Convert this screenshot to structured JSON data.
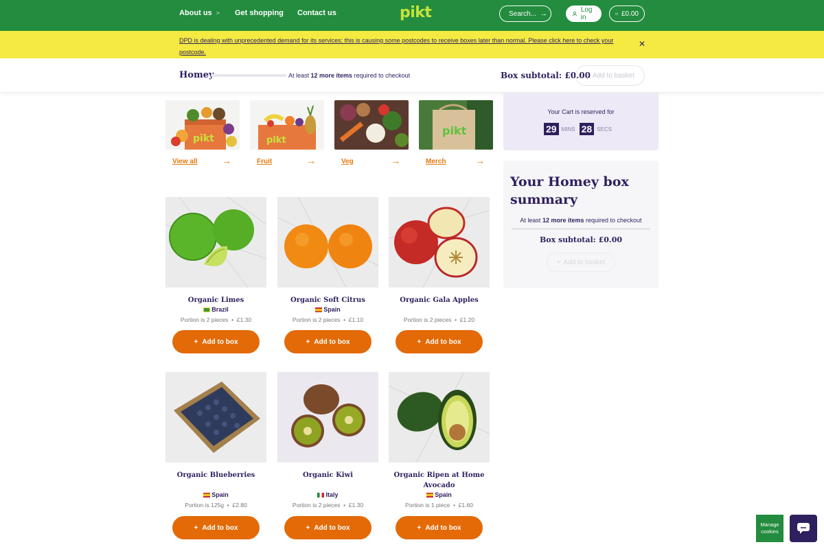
{
  "nav": {
    "about": "About us",
    "shopping": "Get shopping",
    "contact": "Contact us",
    "logo": "pikt",
    "search": "Search...",
    "login": "Log in",
    "cart": "£0.00"
  },
  "banner": {
    "message": "DPD is dealing with unprecedented demand for its services; this is causing some postcodes to receive boxes later than normal. Please click here to check your postcode."
  },
  "progress": {
    "box_name": "Homey",
    "text_prefix": "At least",
    "items_required": "12 more items",
    "text_suffix": "required to checkout",
    "subtotal": "Box subtotal: £0.00",
    "add_to_basket": "Add to basket"
  },
  "categories": [
    {
      "label": "View all"
    },
    {
      "label": "Fruit"
    },
    {
      "label": "Veg"
    },
    {
      "label": "Merch"
    }
  ],
  "products": [
    {
      "name": "Organic Limes",
      "origin": "Brazil",
      "portion": "Portion is 2 pieces",
      "price": "£1.30",
      "button": "Add to box"
    },
    {
      "name": "Organic Soft Citrus",
      "origin": "Spain",
      "portion": "Portion is 2 pieces",
      "price": "£1.10",
      "button": "Add to box"
    },
    {
      "name": "Organic Gala Apples",
      "origin": "",
      "portion": "Portion is 2 pieces",
      "price": "£1.20",
      "button": "Add to box"
    },
    {
      "name": "Organic Blueberries",
      "origin": "Spain",
      "portion": "Portion is 125g",
      "price": "£2.80",
      "button": "Add to box"
    },
    {
      "name": "Organic Kiwi",
      "origin": "Italy",
      "portion": "Portion is 2 pieces",
      "price": "£1.30",
      "button": "Add to box"
    },
    {
      "name": "Organic Ripen at Home Avocado",
      "origin": "Spain",
      "portion": "Portion is 1 piece",
      "price": "£1.60",
      "button": "Add to box"
    }
  ],
  "timer": {
    "label": "Your Cart is reserved for",
    "mins": "29",
    "mins_unit": "MINS",
    "secs": "28",
    "secs_unit": "SECS"
  },
  "summary": {
    "title": "Your Homey box summary",
    "text_prefix": "At least",
    "items_required": "12 more items",
    "text_suffix": "required to checkout",
    "subtotal": "Box subtotal: £0.00",
    "add_to_basket": "Add to basket"
  },
  "widgets": {
    "manage_cookies": "Manage cookies"
  },
  "colors": {
    "header_green": "#238c3e",
    "banner_yellow": "#f4ea42",
    "accent_orange": "#e36a07",
    "text_purple": "#2e1f5e",
    "logo_lime": "#c6e33b"
  }
}
